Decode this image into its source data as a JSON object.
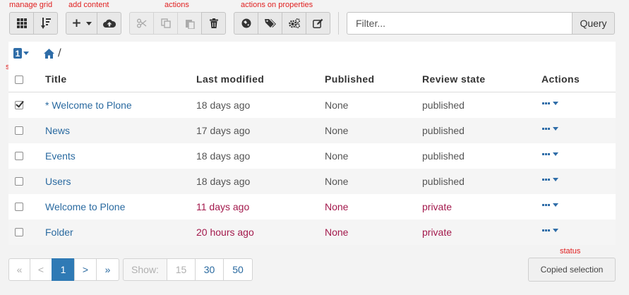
{
  "annotations": {
    "manage_grid": "manage grid",
    "add_content": "add content",
    "actions": "actions",
    "actions_on_properties": "actions on properties",
    "selects": "selects",
    "status": "status"
  },
  "toolbar": {
    "filter_placeholder": "Filter...",
    "query_label": "Query",
    "add_content_symbol": "+",
    "buttons": [
      "grid-icon",
      "sort-icon",
      "plus-icon",
      "upload-icon",
      "scissors-icon",
      "copy-icon",
      "paste-icon",
      "trash-icon",
      "workflow-icon",
      "tags-icon",
      "gears-icon",
      "edit-icon"
    ]
  },
  "selection": {
    "count": "1"
  },
  "breadcrumb": {
    "separator": "/"
  },
  "table": {
    "columns": [
      "Title",
      "Last modified",
      "Published",
      "Review state",
      "Actions"
    ],
    "rows": [
      {
        "title": "* Welcome to Plone",
        "modified": "18 days ago",
        "published": "None",
        "state": "published",
        "checked": true,
        "private": false
      },
      {
        "title": "News",
        "modified": "17 days ago",
        "published": "None",
        "state": "published",
        "checked": false,
        "private": false
      },
      {
        "title": "Events",
        "modified": "18 days ago",
        "published": "None",
        "state": "published",
        "checked": false,
        "private": false
      },
      {
        "title": "Users",
        "modified": "18 days ago",
        "published": "None",
        "state": "published",
        "checked": false,
        "private": false
      },
      {
        "title": "Welcome to Plone",
        "modified": "11 days ago",
        "published": "None",
        "state": "private",
        "checked": false,
        "private": true
      },
      {
        "title": "Folder",
        "modified": "20 hours ago",
        "published": "None",
        "state": "private",
        "checked": false,
        "private": true
      }
    ]
  },
  "pagination": {
    "first": "«",
    "prev": "<",
    "current": "1",
    "next": ">",
    "last": "»",
    "show_label": "Show:",
    "sizes": [
      "15",
      "30",
      "50"
    ]
  },
  "status": {
    "label": "Copied selection"
  },
  "colors": {
    "accent": "#2f7ab5",
    "link": "#2a6aa0",
    "private": "#a3194c",
    "annotation": "#e02020"
  }
}
